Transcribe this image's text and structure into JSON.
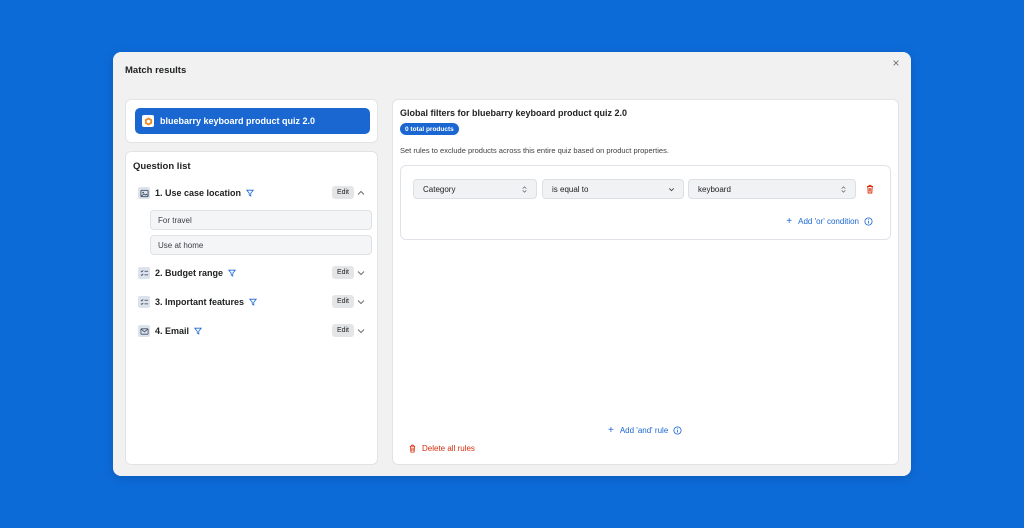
{
  "modal": {
    "title": "Match results",
    "close": "×"
  },
  "quiz": {
    "name": "bluebarry keyboard product quiz 2.0"
  },
  "question_list": {
    "title": "Question list",
    "edit_label": "Edit",
    "questions": [
      {
        "label": "1. Use case location",
        "icon": "image-icon",
        "expanded": true,
        "options": [
          "For travel",
          "Use at home"
        ]
      },
      {
        "label": "2. Budget range",
        "icon": "checklist-icon",
        "expanded": false
      },
      {
        "label": "3. Important features",
        "icon": "checklist-icon",
        "expanded": false
      },
      {
        "label": "4. Email",
        "icon": "mail-icon",
        "expanded": false
      }
    ]
  },
  "filters": {
    "title": "Global filters for bluebarry keyboard product quiz 2.0",
    "badge": "0 total products",
    "description": "Set rules to exclude products across this entire quiz based on product properties.",
    "rule": {
      "field": "Category",
      "operator": "is equal to",
      "value": "keyboard"
    },
    "add_or": "Add 'or' condition",
    "add_and": "Add 'and' rule",
    "delete_all": "Delete all rules"
  },
  "colors": {
    "background": "#0d6bd8",
    "accent": "#1a67d2",
    "danger": "#d72c0d"
  }
}
